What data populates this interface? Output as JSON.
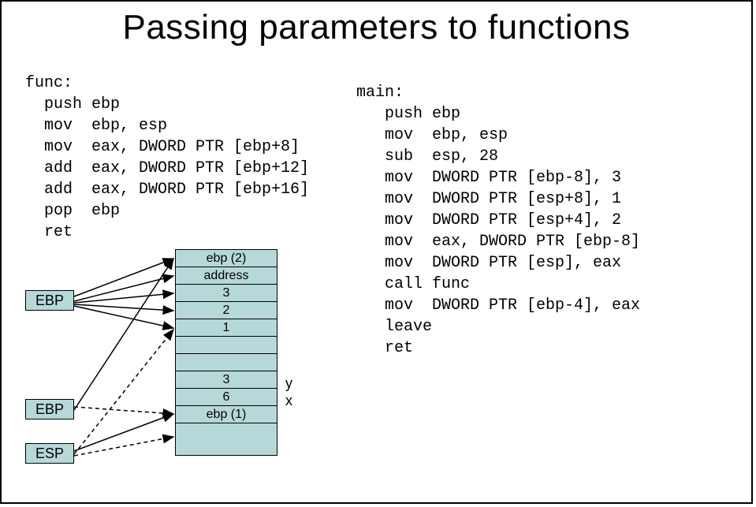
{
  "title": "Passing parameters to functions",
  "func_code": "func:\n  push ebp\n  mov  ebp, esp\n  mov  eax, DWORD PTR [ebp+8]\n  add  eax, DWORD PTR [ebp+12]\n  add  eax, DWORD PTR [ebp+16]\n  pop  ebp\n  ret",
  "main_code": "main:\n   push ebp\n   mov  ebp, esp\n   sub  esp, 28\n   mov  DWORD PTR [ebp-8], 3\n   mov  DWORD PTR [esp+8], 1\n   mov  DWORD PTR [esp+4], 2\n   mov  eax, DWORD PTR [ebp-8]\n   mov  DWORD PTR [esp], eax\n   call func\n   mov  DWORD PTR [ebp-4], eax\n   leave\n   ret",
  "registers": {
    "ebp_top": "EBP",
    "ebp_mid": "EBP",
    "esp": "ESP"
  },
  "stack_slots": {
    "s0": "ebp (2)",
    "s1": "address",
    "s2": "3",
    "s3": "2",
    "s4": "1",
    "s5": "",
    "s6": "",
    "s7": "3",
    "s8": "6",
    "s9": "ebp (1)",
    "s10": ""
  },
  "side_labels": {
    "y": "y",
    "x": "x"
  }
}
